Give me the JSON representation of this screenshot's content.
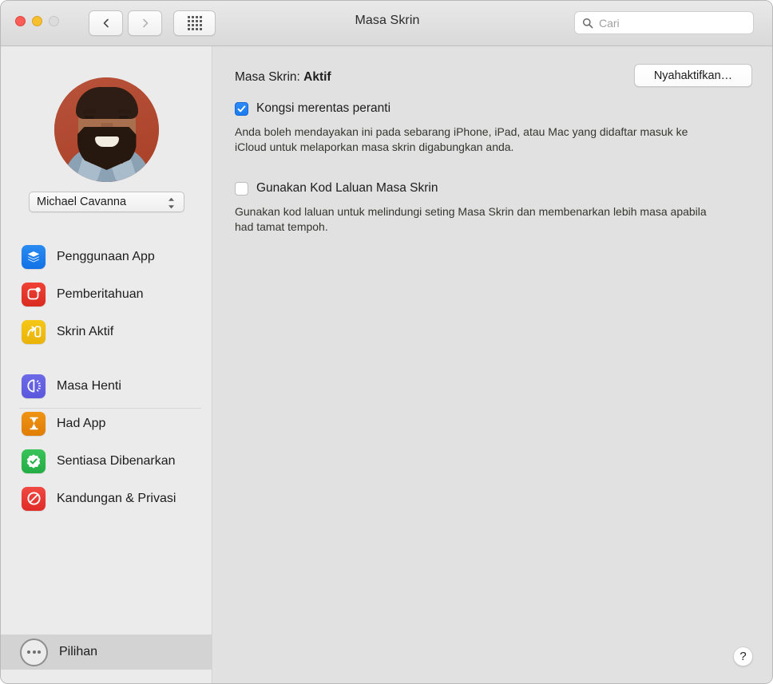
{
  "window": {
    "title": "Masa Skrin",
    "traffic_lights": [
      "close-button",
      "minimize-button",
      "zoom-button"
    ]
  },
  "toolbar": {
    "back_icon": "chevron-left-icon",
    "forward_icon": "chevron-right-icon",
    "showall_icon": "grid-icon",
    "search": {
      "placeholder": "Cari",
      "value": "",
      "icon": "search-icon"
    }
  },
  "sidebar": {
    "avatar": {
      "name": "user-avatar-photo",
      "background_color": "#b34b32"
    },
    "user_popup": {
      "value": "Michael Cavanna",
      "icon": "up-down-chevron-icon"
    },
    "group_one": [
      {
        "label": "Penggunaan App",
        "icon": "app-usage-icon",
        "color": "#1272e6"
      },
      {
        "label": "Pemberitahuan",
        "icon": "notifications-icon",
        "color": "#d92b20"
      },
      {
        "label": "Skrin Aktif",
        "icon": "pickups-icon",
        "color": "#eab308"
      }
    ],
    "group_two": [
      {
        "label": "Masa Henti",
        "icon": "downtime-icon",
        "color": "#5a57dd"
      },
      {
        "label": "Had App",
        "icon": "app-limits-icon",
        "color": "#e07d06"
      },
      {
        "label": "Sentiasa Dibenarkan",
        "icon": "always-allowed-icon",
        "color": "#24ad45"
      },
      {
        "label": "Kandungan & Privasi",
        "icon": "content-privacy-icon",
        "color": "#e02b26"
      }
    ],
    "options_row": {
      "label": "Pilihan",
      "icon": "ellipsis-circle-icon",
      "selected": true
    }
  },
  "main": {
    "status_prefix": "Masa Skrin: ",
    "status_value": "Aktif",
    "turn_off_button": "Nyahaktifkan…",
    "share_checkbox": {
      "label": "Kongsi merentas peranti",
      "checked": true,
      "description": "Anda boleh mendayakan ini pada sebarang iPhone, iPad, atau Mac yang didaftar masuk ke iCloud untuk melaporkan masa skrin digabungkan anda."
    },
    "passcode_checkbox": {
      "label": "Gunakan Kod Laluan Masa Skrin",
      "checked": false,
      "description": "Gunakan kod laluan untuk melindungi seting Masa Skrin dan membenarkan lebih masa apabila had tamat tempoh."
    },
    "help_button": "?"
  }
}
